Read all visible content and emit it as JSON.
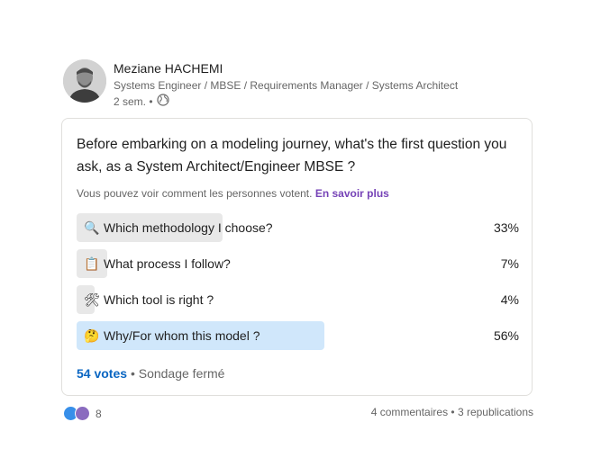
{
  "author": {
    "name": "Meziane HACHEMI",
    "headline": "Systems Engineer / MBSE / Requirements Manager / Systems Architect",
    "time": "2 sem. •"
  },
  "poll": {
    "question": "Before embarking on a modeling journey, what's the first question you ask, as a System Architect/Engineer MBSE ?",
    "visibility_text": "Vous pouvez voir comment les personnes votent.",
    "learn_more": "En savoir plus",
    "options": [
      {
        "emoji": "🔍",
        "label": "Which methodology I choose?",
        "percent_label": "33%",
        "percent": 33,
        "selected": false
      },
      {
        "emoji": "📋",
        "label": "What process I follow?",
        "percent_label": "7%",
        "percent": 7,
        "selected": false
      },
      {
        "emoji": "🛠",
        "label": "Which tool is right ?",
        "percent_label": "4%",
        "percent": 4,
        "selected": false
      },
      {
        "emoji": "🤔",
        "label": "Why/For whom this model ?",
        "percent_label": "56%",
        "percent": 56,
        "selected": true
      }
    ],
    "votes": "54 votes",
    "status": "• Sondage fermé"
  },
  "social": {
    "reactions_count": "8",
    "comments_reposts": "4 commentaires • 3 republications"
  },
  "colors": {
    "bar": "#e8e8e8",
    "bar_selected": "#d0e7fb",
    "link_blue": "#0a66c2",
    "link_purple": "#7643b7"
  }
}
